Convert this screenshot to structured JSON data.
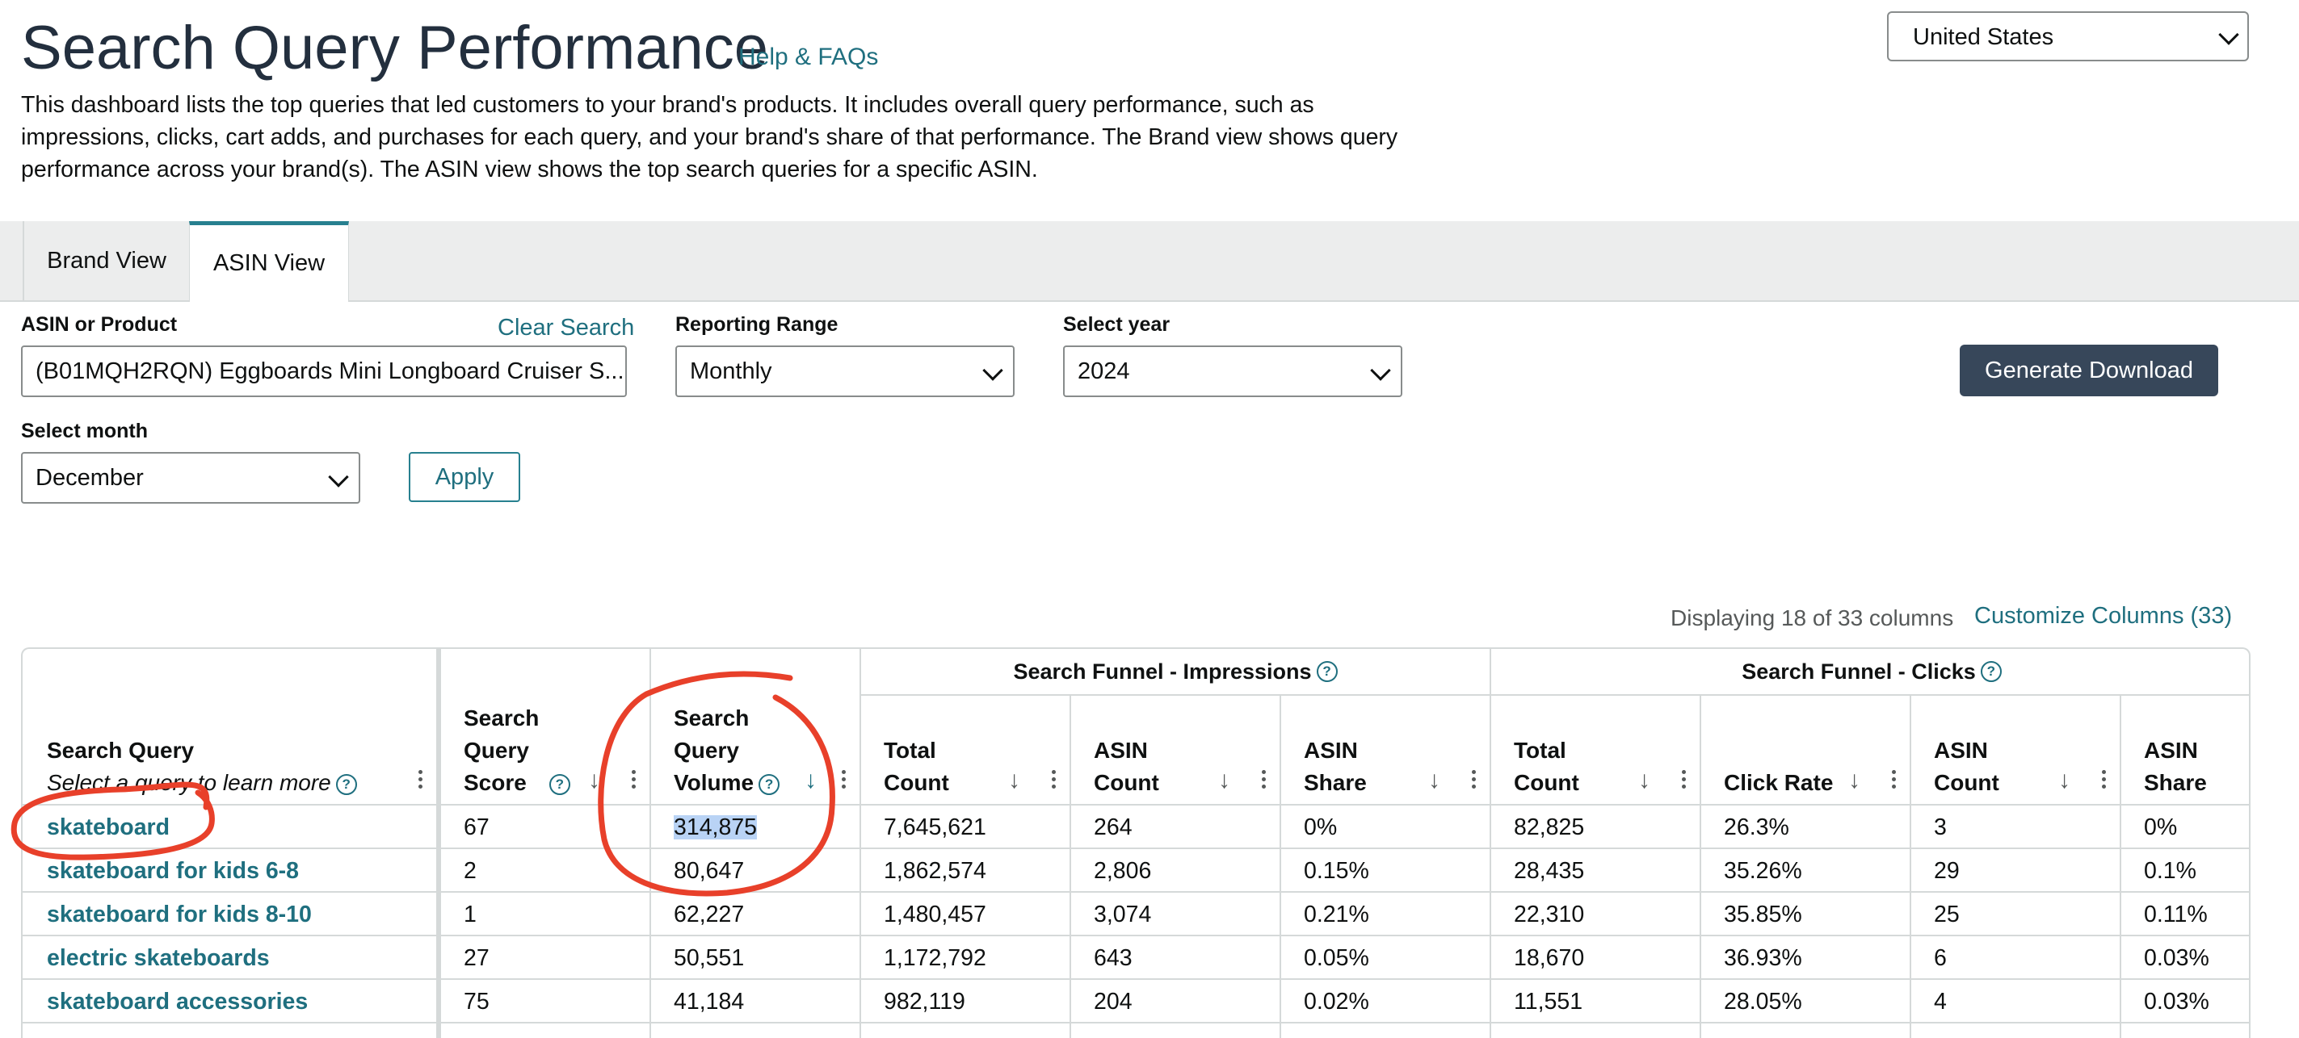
{
  "header": {
    "title": "Search Query Performance",
    "help_link": "Help & FAQs",
    "description": "This dashboard lists the top queries that led customers to your brand's products. It includes overall query performance, such as impressions, clicks, cart adds, and purchases for each query, and your brand's share of that performance. The Brand view shows query performance across your brand(s). The ASIN view shows the top search queries for a specific ASIN.",
    "country": "United States"
  },
  "tabs": [
    {
      "label": "Brand View",
      "active": false
    },
    {
      "label": "ASIN View",
      "active": true
    }
  ],
  "filters": {
    "asin_label": "ASIN or Product",
    "clear_search": "Clear Search",
    "asin_value": "(B01MQH2RQN) Eggboards Mini Longboard Cruiser S...",
    "range_label": "Reporting Range",
    "range_value": "Monthly",
    "year_label": "Select year",
    "year_value": "2024",
    "month_label": "Select month",
    "month_value": "December",
    "apply": "Apply",
    "generate": "Generate Download"
  },
  "columns_info": {
    "displaying": "Displaying 18 of 33 columns",
    "customize": "Customize Columns (33)"
  },
  "table": {
    "groups": {
      "impressions": "Search Funnel - Impressions",
      "clicks": "Search Funnel - Clicks"
    },
    "headers": {
      "query": "Search Query",
      "query_sub": "Select a query to learn more",
      "score_1": "Search",
      "score_2": "Query",
      "score_3": "Score",
      "volume_1": "Search",
      "volume_2": "Query",
      "volume_3": "Volume",
      "total_1": "Total",
      "total_2": "Count",
      "asin_count_1": "ASIN",
      "asin_count_2": "Count",
      "asin_share_1": "ASIN",
      "asin_share_2": "Share",
      "click_rate": "Click Rate"
    },
    "rows": [
      {
        "query": "skateboard",
        "score": "67",
        "volume": "314,875",
        "imp_total": "7,645,621",
        "imp_asin": "264",
        "imp_share": "0%",
        "clk_total": "82,825",
        "clk_rate": "26.3%",
        "clk_asin": "3",
        "clk_share": "0%"
      },
      {
        "query": "skateboard for kids 6-8",
        "score": "2",
        "volume": "80,647",
        "imp_total": "1,862,574",
        "imp_asin": "2,806",
        "imp_share": "0.15%",
        "clk_total": "28,435",
        "clk_rate": "35.26%",
        "clk_asin": "29",
        "clk_share": "0.1%"
      },
      {
        "query": "skateboard for kids 8-10",
        "score": "1",
        "volume": "62,227",
        "imp_total": "1,480,457",
        "imp_asin": "3,074",
        "imp_share": "0.21%",
        "clk_total": "22,310",
        "clk_rate": "35.85%",
        "clk_asin": "25",
        "clk_share": "0.11%"
      },
      {
        "query": "electric skateboards",
        "score": "27",
        "volume": "50,551",
        "imp_total": "1,172,792",
        "imp_asin": "643",
        "imp_share": "0.05%",
        "clk_total": "18,670",
        "clk_rate": "36.93%",
        "clk_asin": "6",
        "clk_share": "0.03%"
      },
      {
        "query": "skateboard accessories",
        "score": "75",
        "volume": "41,184",
        "imp_total": "982,119",
        "imp_asin": "204",
        "imp_share": "0.02%",
        "clk_total": "11,551",
        "clk_rate": "28.05%",
        "clk_asin": "4",
        "clk_share": "0.03%"
      }
    ]
  },
  "colors": {
    "accent": "#1f6f7f",
    "dark_button": "#37475a",
    "annotation": "#e8402a",
    "highlight": "#b9d3f5"
  }
}
